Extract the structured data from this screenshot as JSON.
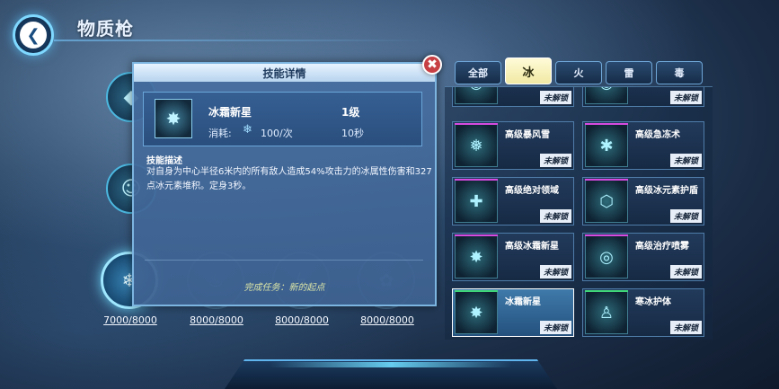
{
  "header": {
    "title": "物质枪",
    "back_icon": "back-arrow-icon"
  },
  "popup": {
    "title": "技能详情",
    "close_symbol": "✖",
    "skill": {
      "name": "冰霜新星",
      "level": "1级",
      "cost_label": "消耗:",
      "cost_icon": "snowflake-icon",
      "cost_value": "100/次",
      "cooldown": "10秒"
    },
    "description_title": "技能描述",
    "description": "对自身为中心半径6米内的所有敌人造成54%攻击力的冰属性伤害和327点冰元素堆积。定身3秒。",
    "task": "完成任务：新的起点"
  },
  "weapon_slots": [
    {
      "value": "7000/8000",
      "active": true
    },
    {
      "value": "8000/8000",
      "active": false
    },
    {
      "value": "8000/8000",
      "active": false
    },
    {
      "value": "8000/8000",
      "active": false
    }
  ],
  "tabs": [
    {
      "label": "全部",
      "selected": false
    },
    {
      "label": "冰",
      "selected": true
    },
    {
      "label": "火",
      "selected": false
    },
    {
      "label": "雷",
      "selected": false
    },
    {
      "label": "毒",
      "selected": false
    }
  ],
  "skills": [
    {
      "name": "",
      "lock": "未解锁",
      "selected": false,
      "top_color": "purple"
    },
    {
      "name": "",
      "lock": "未解锁",
      "selected": false,
      "top_color": "purple"
    },
    {
      "name": "高级暴风雪",
      "lock": "未解锁",
      "selected": false,
      "top_color": "purple"
    },
    {
      "name": "高级急冻术",
      "lock": "未解锁",
      "selected": false,
      "top_color": "purple"
    },
    {
      "name": "高级绝对领域",
      "lock": "未解锁",
      "selected": false,
      "top_color": "purple"
    },
    {
      "name": "高级冰元素护盾",
      "lock": "未解锁",
      "selected": false,
      "top_color": "purple"
    },
    {
      "name": "高级冰霜新星",
      "lock": "未解锁",
      "selected": false,
      "top_color": "purple"
    },
    {
      "name": "高级治疗喷雾",
      "lock": "未解锁",
      "selected": false,
      "top_color": "purple"
    },
    {
      "name": "冰霜新星",
      "lock": "未解锁",
      "selected": true,
      "top_color": "green"
    },
    {
      "name": "寒冰护体",
      "lock": "未解锁",
      "selected": false,
      "top_color": "green"
    }
  ],
  "colors": {
    "accent": "#7fd8ff",
    "tab_selected": "#f1e9a3",
    "tile_top_purple": "#d64ae0",
    "tile_top_green": "#3fd67a",
    "close_button": "#c74044"
  }
}
